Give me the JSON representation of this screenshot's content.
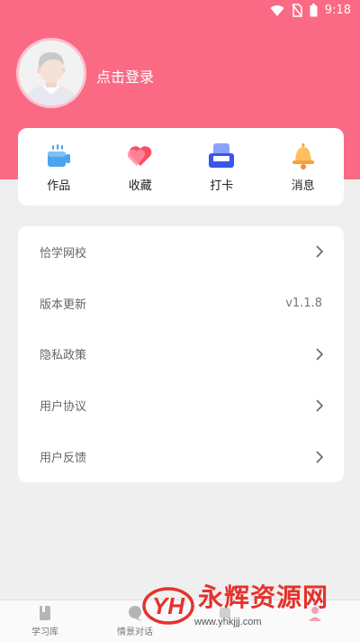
{
  "status_bar": {
    "time": "9:18",
    "icons": [
      "wifi-icon",
      "no-sim-icon",
      "battery-icon"
    ]
  },
  "profile": {
    "login_text": "点击登录",
    "avatar_icon": "default-avatar"
  },
  "quick_actions": [
    {
      "label": "作品",
      "icon": "works-icon"
    },
    {
      "label": "收藏",
      "icon": "favorites-heart-icon"
    },
    {
      "label": "打卡",
      "icon": "checkin-sofa-icon"
    },
    {
      "label": "消息",
      "icon": "bell-icon"
    }
  ],
  "menu": [
    {
      "label": "恰学网校",
      "value": ""
    },
    {
      "label": "版本更新",
      "value": "v1.1.8"
    },
    {
      "label": "隐私政策",
      "value": ""
    },
    {
      "label": "用户协议",
      "value": ""
    },
    {
      "label": "用户反馈",
      "value": ""
    }
  ],
  "tabs": [
    {
      "label": "学习库",
      "icon": "book-icon"
    },
    {
      "label": "情景对话",
      "icon": "chat-icon"
    },
    {
      "label": "",
      "icon": "tab-icon"
    },
    {
      "label": "",
      "icon": "profile-icon"
    }
  ],
  "watermark": {
    "logo_text": "YH",
    "title": "永辉资源网",
    "url": "www.yhkjjj.com"
  },
  "colors": {
    "header_bg": "#fb6a85",
    "page_bg": "#efefef",
    "card_bg": "#ffffff",
    "watermark_red": "#e5322d"
  }
}
